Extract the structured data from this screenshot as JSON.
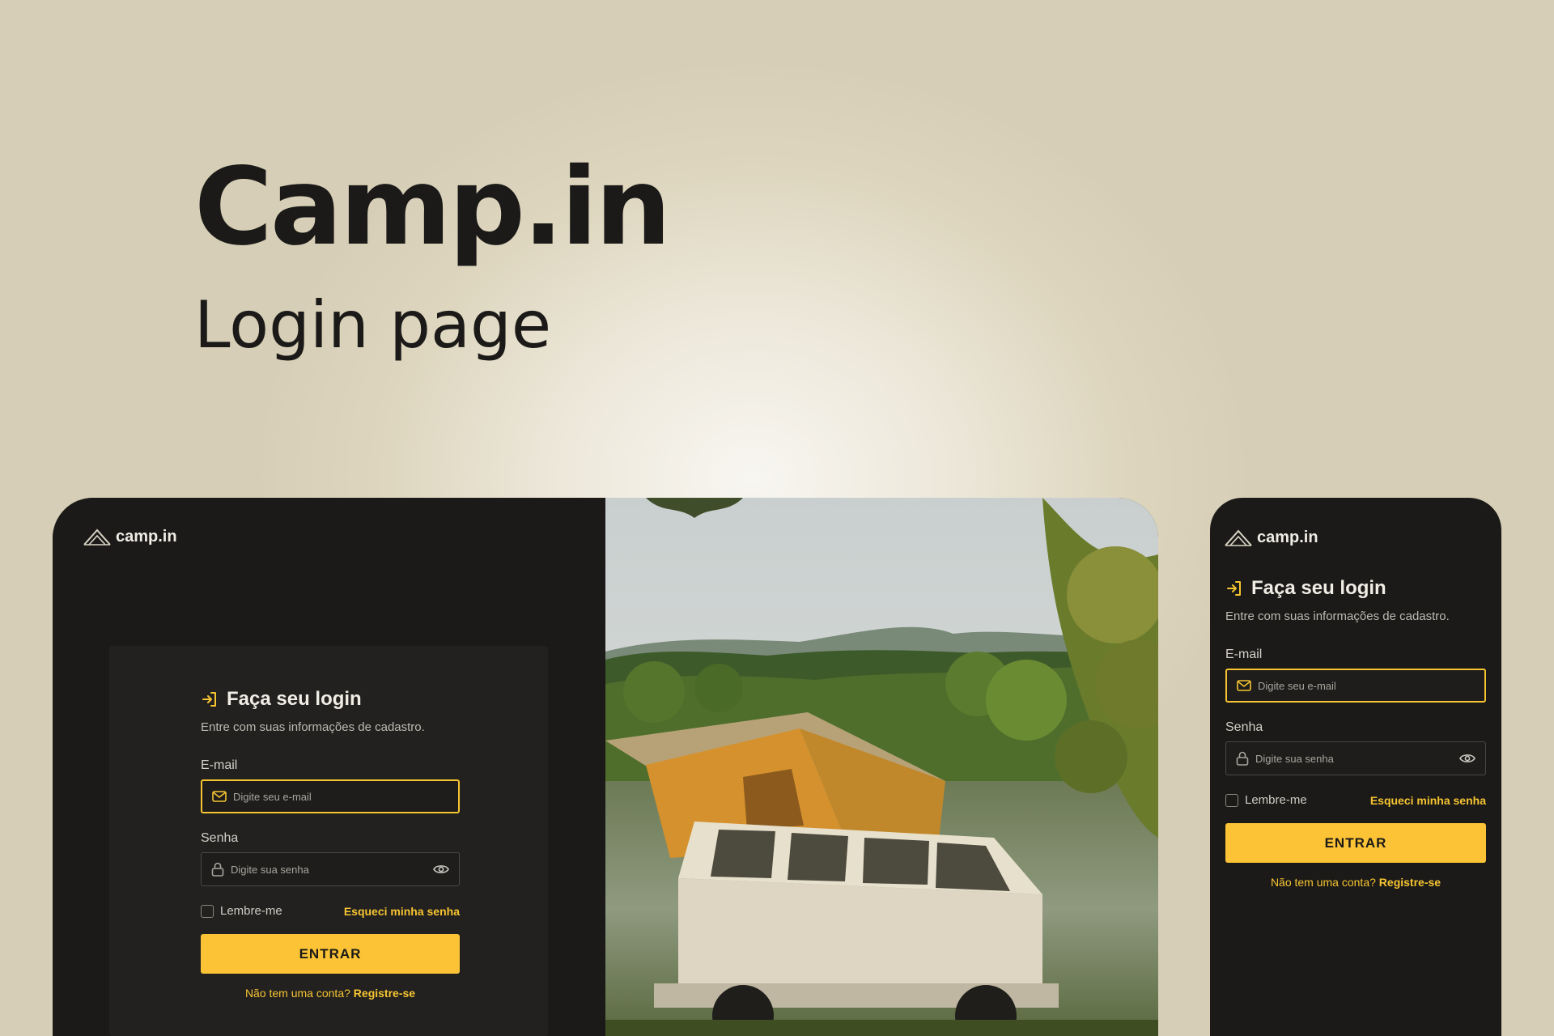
{
  "hero": {
    "title": "Camp.in",
    "subtitle": "Login page"
  },
  "brand": {
    "name": "camp.in"
  },
  "login": {
    "title": "Faça seu login",
    "subtitle": "Entre com suas informações de cadastro.",
    "email_label": "E-mail",
    "email_placeholder": "Digite seu e-mail",
    "password_label": "Senha",
    "password_placeholder": "Digite sua senha",
    "remember_label": "Lembre-me",
    "forgot_label": "Esqueci minha senha",
    "submit_label": "ENTRAR",
    "signup_prompt": "Não tem uma conta?",
    "signup_link": "Registre-se"
  },
  "colors": {
    "accent": "#fbc335",
    "dark": "#1b1a18",
    "panel": "#22211f",
    "background": "#ddd5bd"
  },
  "icons": [
    "tent-logo-icon",
    "login-arrow-icon",
    "mail-icon",
    "lock-icon",
    "eye-icon"
  ]
}
